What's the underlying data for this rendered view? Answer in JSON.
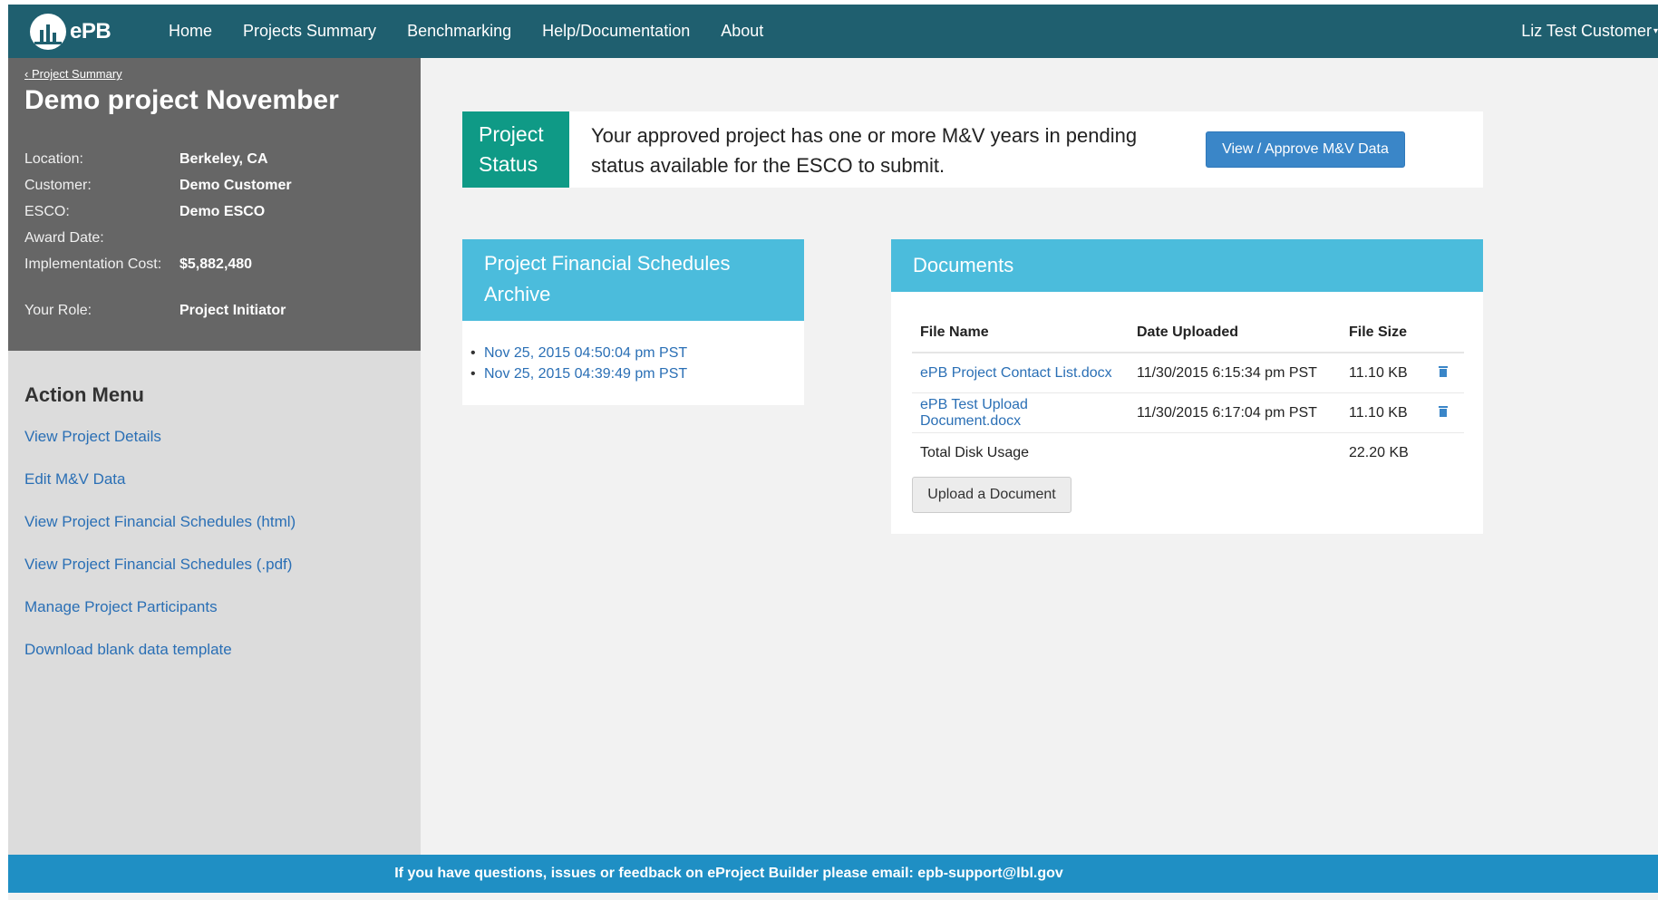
{
  "navbar": {
    "logo_text": "ePB",
    "links": [
      "Home",
      "Projects Summary",
      "Benchmarking",
      "Help/Documentation",
      "About"
    ],
    "user": "Liz Test Customer"
  },
  "sidebar": {
    "back_link": "Project Summary",
    "project_title": "Demo project November",
    "info": [
      {
        "label": "Location:",
        "value": "Berkeley, CA"
      },
      {
        "label": "Customer:",
        "value": "Demo Customer"
      },
      {
        "label": "ESCO:",
        "value": "Demo ESCO"
      },
      {
        "label": "Award Date:",
        "value": ""
      },
      {
        "label": "Implementation Cost:",
        "value": "$5,882,480"
      },
      {
        "label": "Your Role:",
        "value": "Project Initiator"
      }
    ],
    "action_menu_title": "Action Menu",
    "actions": [
      "View Project Details",
      "Edit M&V Data",
      "View Project Financial Schedules (html)",
      "View Project Financial Schedules (.pdf)",
      "Manage Project Participants",
      "Download blank data template"
    ]
  },
  "status": {
    "label": "Project Status",
    "message": "Your approved project has one or more M&V years in pending status available for the ESCO to submit.",
    "button_label": "View / Approve M&V Data"
  },
  "archive": {
    "title": "Project Financial Schedules Archive",
    "items": [
      "Nov 25, 2015 04:50:04 pm PST",
      "Nov 25, 2015 04:39:49 pm PST"
    ]
  },
  "documents": {
    "title": "Documents",
    "columns": [
      "File Name",
      "Date Uploaded",
      "File Size"
    ],
    "rows": [
      {
        "name": "ePB Project Contact List.docx",
        "date": "11/30/2015 6:15:34 pm PST",
        "size": "11.10 KB"
      },
      {
        "name": "ePB Test Upload Document.docx",
        "date": "11/30/2015 6:17:04 pm PST",
        "size": "11.10 KB"
      }
    ],
    "total_label": "Total Disk Usage",
    "total_value": "22.20 KB",
    "upload_label": "Upload a Document"
  },
  "footer": {
    "text": "If you have questions, issues or feedback on eProject Builder please email: epb-support@lbl.gov"
  },
  "colors": {
    "navbar": "#1f5f6f",
    "status_label": "#0f9a86",
    "panel_heading": "#4bbcdc",
    "footer": "#1f8fc4",
    "link": "#2a6fb5"
  }
}
